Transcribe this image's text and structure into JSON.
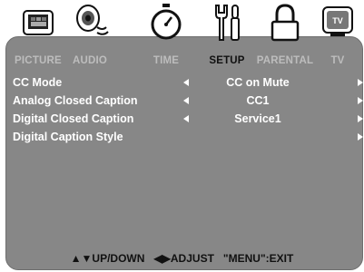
{
  "tabs": [
    {
      "label": "PICTURE",
      "icon": "picture-icon",
      "active": false
    },
    {
      "label": "AUDIO",
      "icon": "speaker-icon",
      "active": false
    },
    {
      "label": "TIME",
      "icon": "stopwatch-icon",
      "active": false
    },
    {
      "label": "SETUP",
      "icon": "tools-icon",
      "active": true
    },
    {
      "label": "PARENTAL",
      "icon": "lock-icon",
      "active": false
    },
    {
      "label": "TV",
      "icon": "tv-icon",
      "active": false
    }
  ],
  "rows": [
    {
      "label": "CC Mode",
      "value": "CC on Mute",
      "left_arrow": true,
      "right_arrow": true
    },
    {
      "label": "Analog Closed Caption",
      "value": "CC1",
      "left_arrow": true,
      "right_arrow": true
    },
    {
      "label": "Digital Closed Caption",
      "value": "Service1",
      "left_arrow": true,
      "right_arrow": true
    },
    {
      "label": "Digital Caption Style",
      "value": "",
      "left_arrow": false,
      "right_arrow": true
    }
  ],
  "footer": {
    "updown": "▲▼UP/DOWN",
    "adjust": "◀▶ADJUST",
    "exit": "\"MENU\":EXIT"
  },
  "colors": {
    "panel": "#878787",
    "active_label": "#111111",
    "inactive_label": "#bdbdbd",
    "text": "#ffffff"
  }
}
